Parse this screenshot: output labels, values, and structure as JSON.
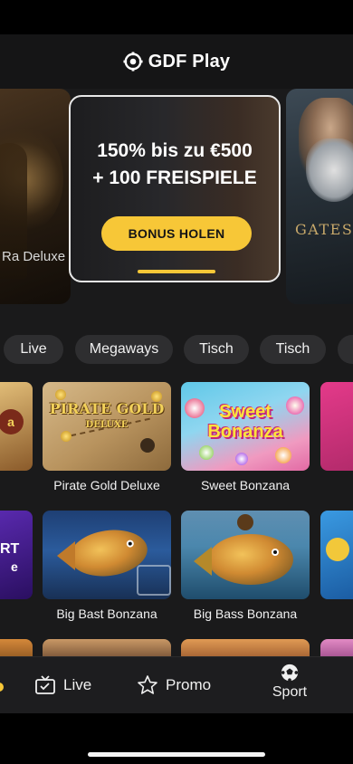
{
  "app": {
    "name": "GDF Play"
  },
  "hero": {
    "left_slide_caption": "Ra Deluxe",
    "right_slide_caption": "GATES G",
    "promo": {
      "line1": "150% bis zu €500",
      "line2": "+ 100 FREISPIELE",
      "button_label": "BONUS HOLEN"
    }
  },
  "filters": [
    "Live",
    "Megaways",
    "Tisch",
    "Tisch"
  ],
  "games": [
    {
      "title": "Pirate Gold Deluxe",
      "art_title": "PIRATE GOLD",
      "art_sub": "DELUXE"
    },
    {
      "title": "Sweet Bonzana",
      "art_title": "Sweet Bonanza"
    },
    {
      "title": "Big Bast Bonzana"
    },
    {
      "title": "Big Bass Bonzana"
    }
  ],
  "peek_text": {
    "left_top": "a",
    "left_mid_1": "RT",
    "left_mid_2": "e"
  },
  "bottom_nav": {
    "live": "Live",
    "promo": "Promo",
    "sport": "Sport"
  },
  "colors": {
    "accent": "#f7c737",
    "background": "#1a1a1b",
    "chip": "#2e2e30"
  }
}
